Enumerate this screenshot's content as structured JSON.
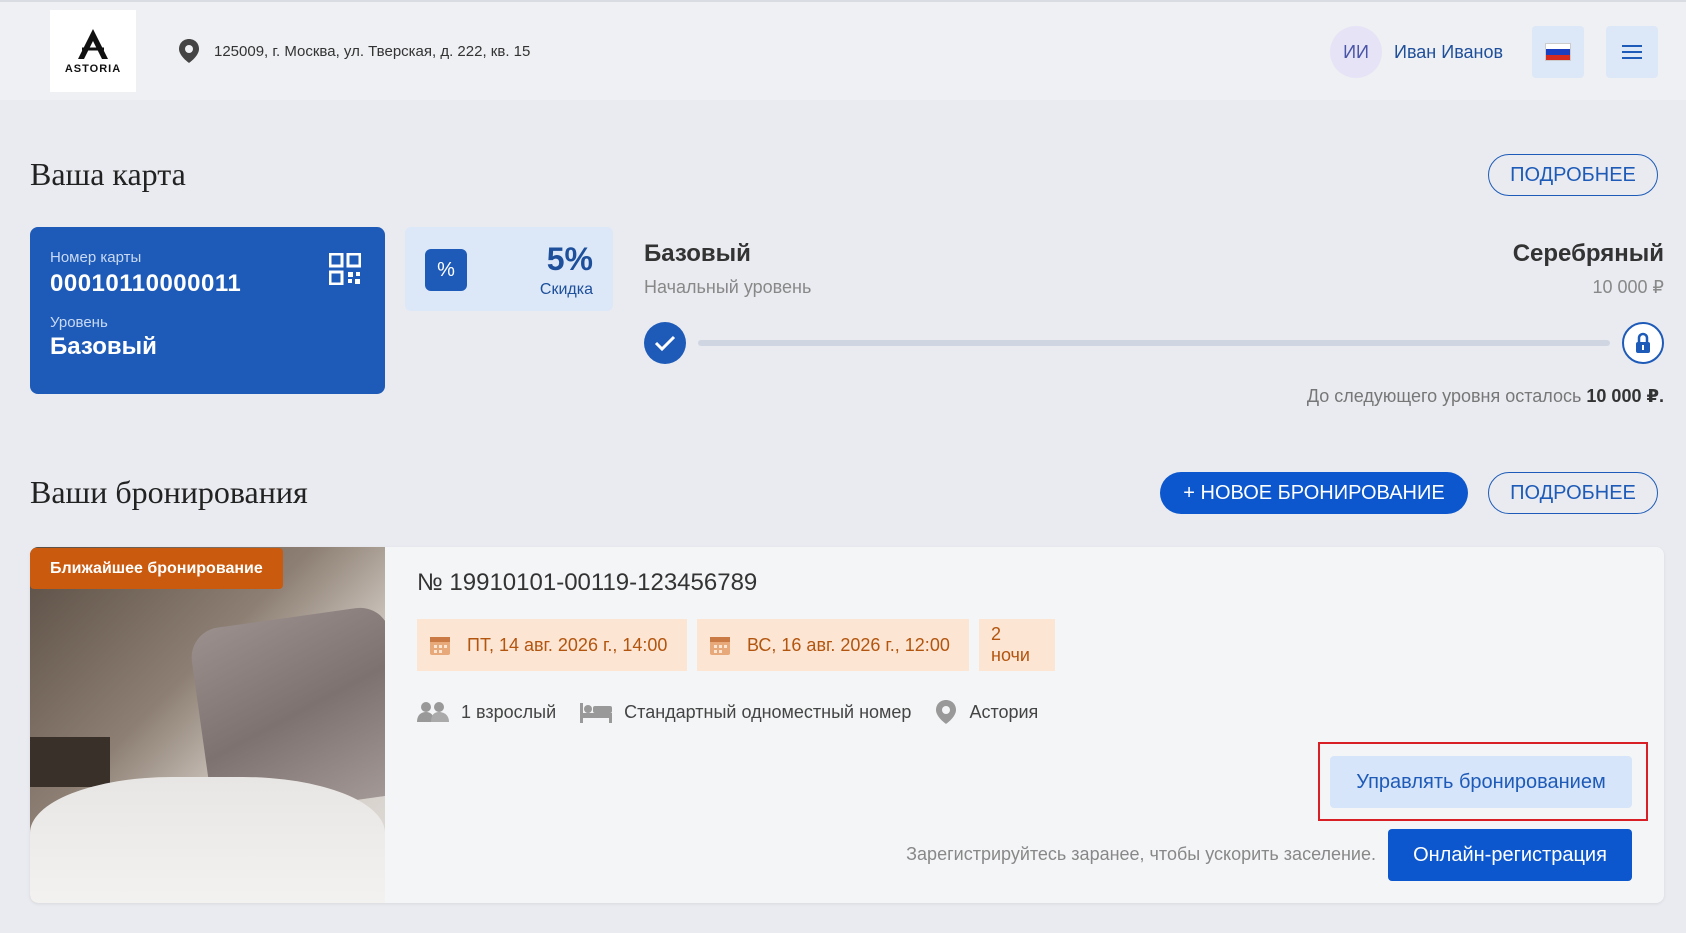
{
  "header": {
    "logo_text": "ASTORIA",
    "address": "125009, г. Москва, ул. Тверская, д. 222, кв. 15",
    "user_initials": "ИИ",
    "user_name": "Иван Иванов",
    "language_flag": "ru-flag-icon",
    "menu_icon": "hamburger-menu-icon"
  },
  "card_section": {
    "title": "Ваша карта",
    "details_label": "ПОДРОБНЕЕ",
    "card": {
      "number_label": "Номер карты",
      "number": "00010110000011",
      "level_label": "Уровень",
      "level": "Базовый"
    },
    "discount": {
      "value": "5%",
      "label": "Скидка"
    },
    "progress": {
      "current_level": "Базовый",
      "current_level_sub": "Начальный уровень",
      "next_level": "Серебряный",
      "next_level_amount": "10 000 ₽",
      "progress_fraction": 0,
      "remaining_prefix": "До следующего уровня осталось",
      "remaining_amount": "10 000 ₽."
    }
  },
  "bookings_section": {
    "title": "Ваши бронирования",
    "new_booking_label": "+ НОВОЕ БРОНИРОВАНИЕ",
    "details_label": "ПОДРОБНЕЕ",
    "booking": {
      "badge": "Ближайшее бронирование",
      "number": "№ 19910101-00119-123456789",
      "check_in": "ПТ, 14 авг. 2026 г., 14:00",
      "check_out": "ВС, 16 авг. 2026 г., 12:00",
      "nights": "2 ночи",
      "guests": "1 взрослый",
      "room": "Стандартный одноместный номер",
      "hotel": "Астория",
      "manage_label": "Управлять бронированием",
      "registration_hint": "Зарегистрируйтесь заранее, чтобы ускорить заселение.",
      "registration_label": "Онлайн-регистрация"
    }
  },
  "colors": {
    "primary": "#1e5bb8",
    "accent_orange": "#c95a0e",
    "chip_bg": "#fde5d3",
    "highlight_frame": "#d81f26"
  }
}
